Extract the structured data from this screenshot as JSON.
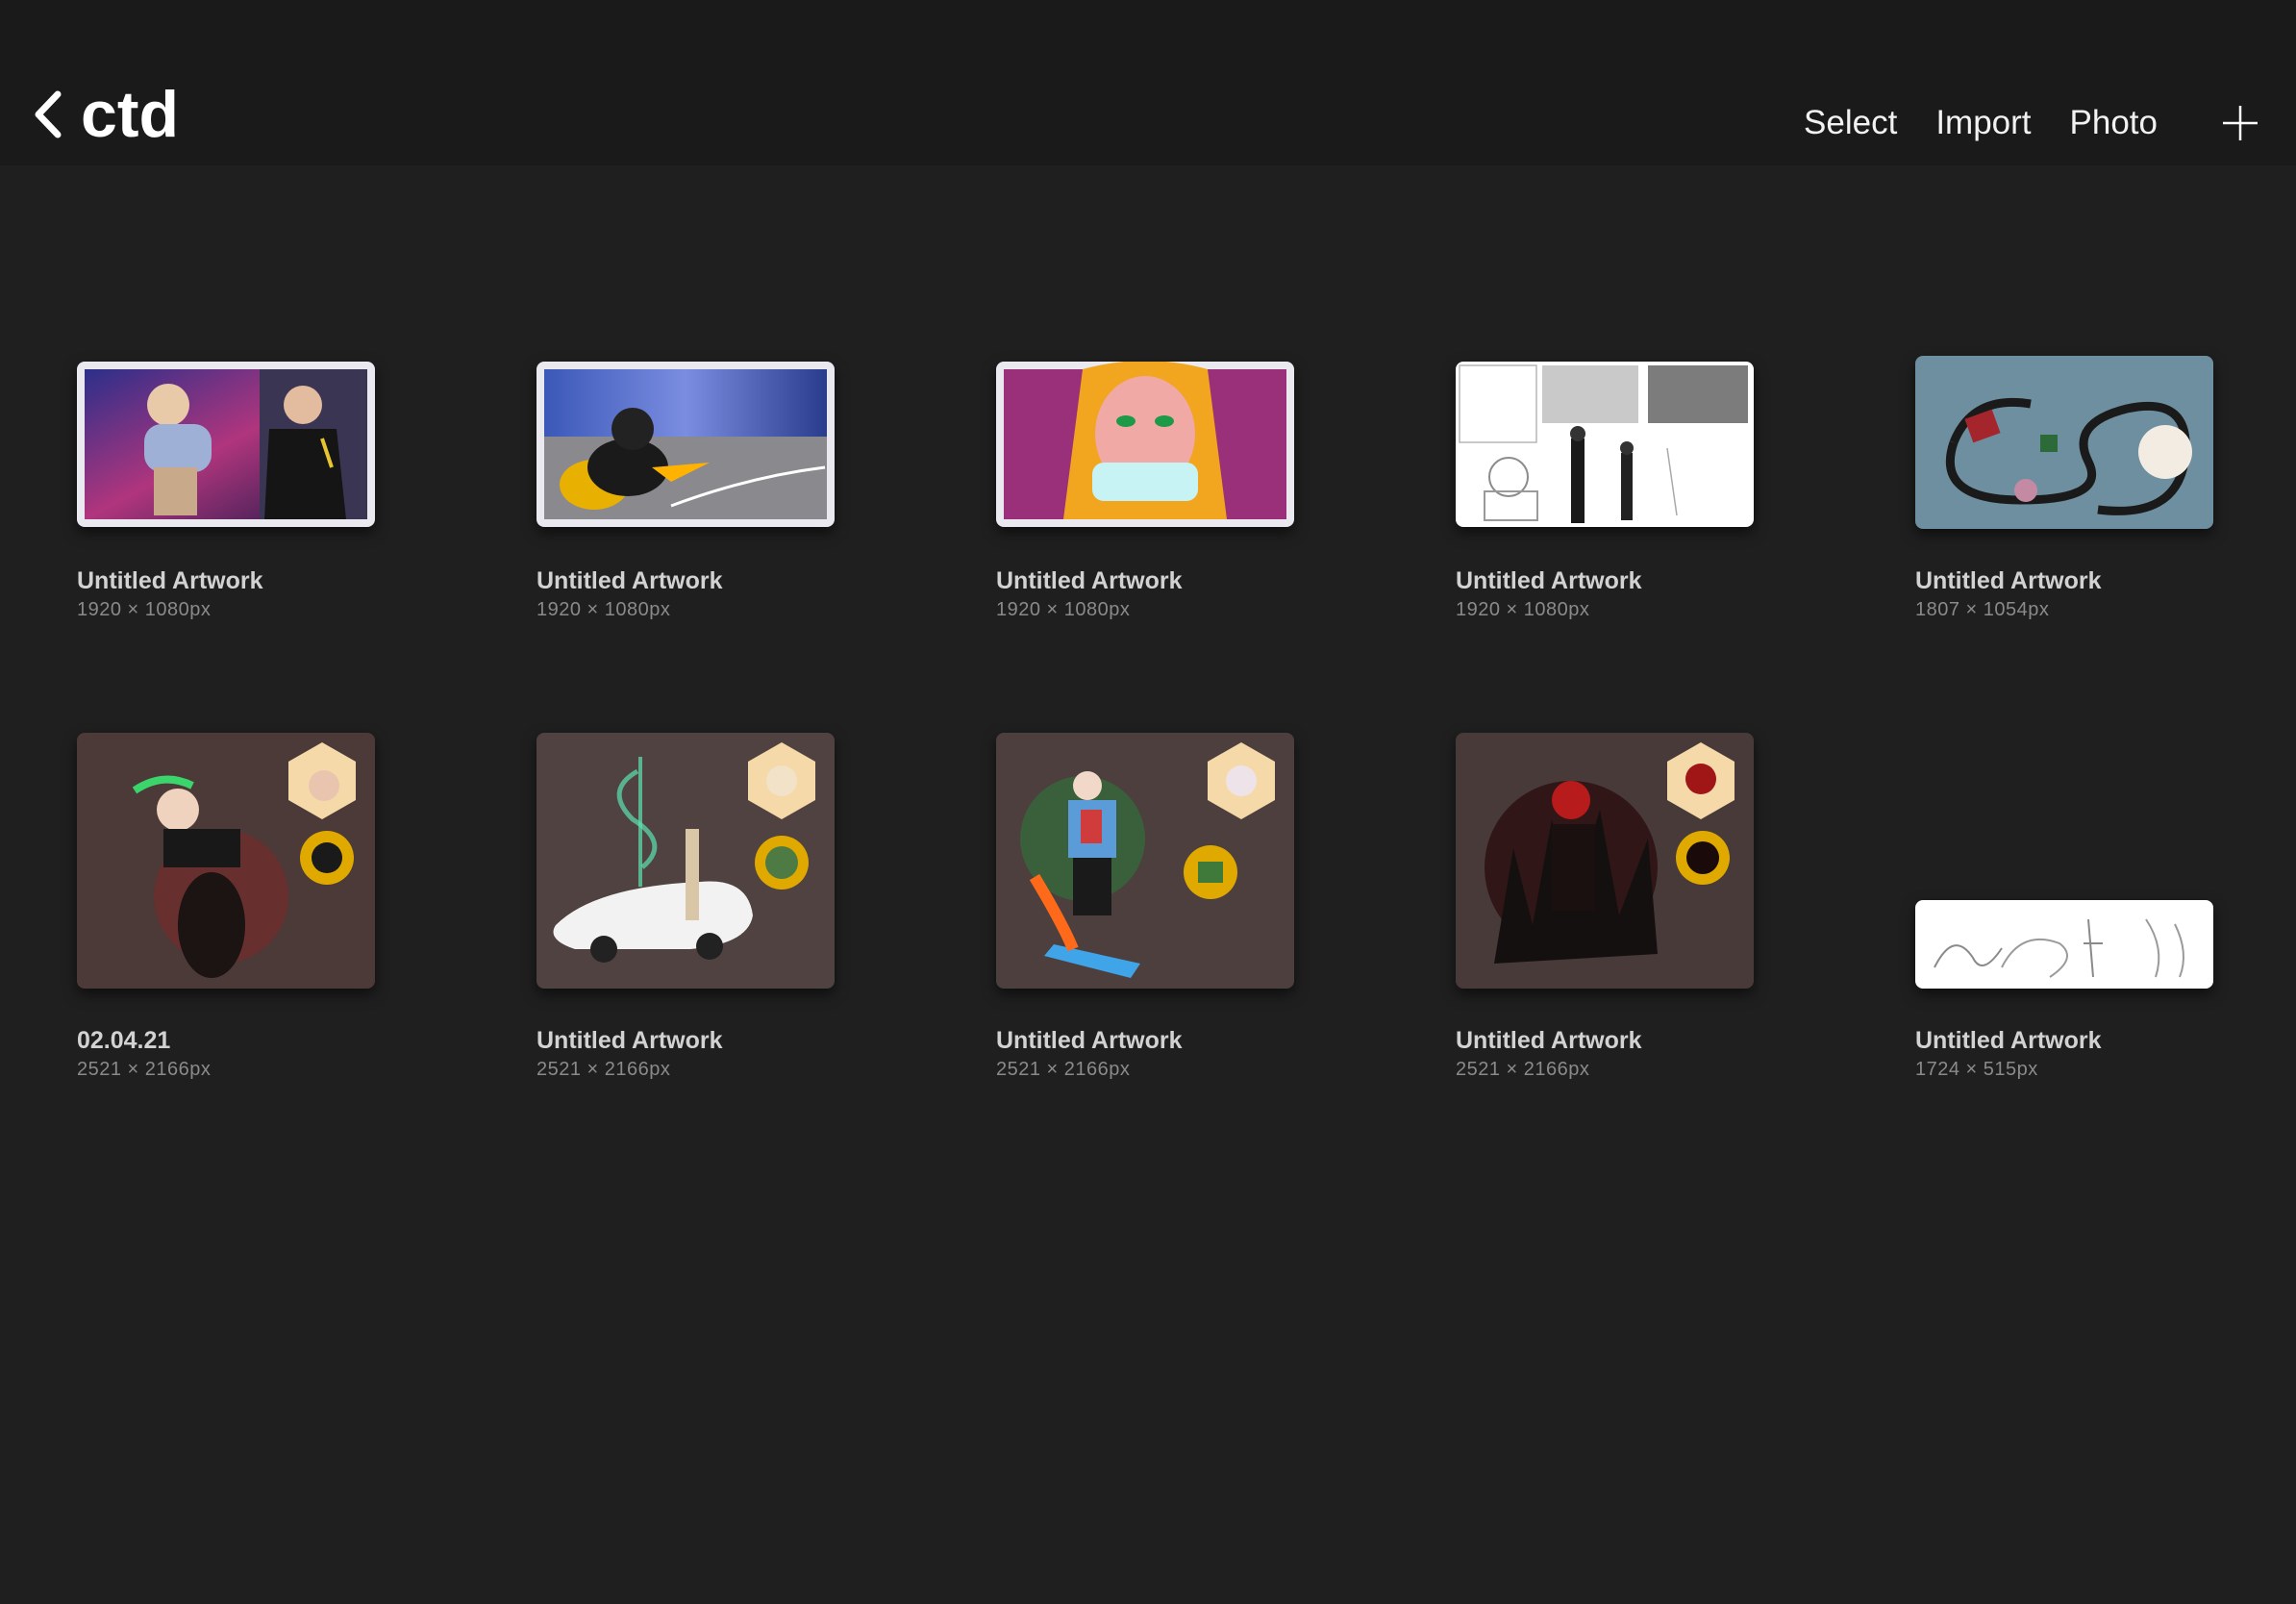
{
  "header": {
    "back_label": "ctd",
    "actions": {
      "select": "Select",
      "import": "Import",
      "photo": "Photo"
    }
  },
  "artworks": [
    {
      "name": "Untitled Artwork",
      "dims": "1920 × 1080px"
    },
    {
      "name": "Untitled Artwork",
      "dims": "1920 × 1080px"
    },
    {
      "name": "Untitled Artwork",
      "dims": "1920 × 1080px"
    },
    {
      "name": "Untitled Artwork",
      "dims": "1920 × 1080px"
    },
    {
      "name": "Untitled Artwork",
      "dims": "1807 × 1054px"
    },
    {
      "name": "02.04.21",
      "dims": "2521 × 2166px"
    },
    {
      "name": "Untitled Artwork",
      "dims": "2521 × 2166px"
    },
    {
      "name": "Untitled Artwork",
      "dims": "2521 × 2166px"
    },
    {
      "name": "Untitled Artwork",
      "dims": "2521 × 2166px"
    },
    {
      "name": "Untitled Artwork",
      "dims": "1724 × 515px"
    }
  ],
  "colors": {
    "background": "#1f1f1f",
    "topbar": "#1a1a1a",
    "text": "#ffffff"
  }
}
